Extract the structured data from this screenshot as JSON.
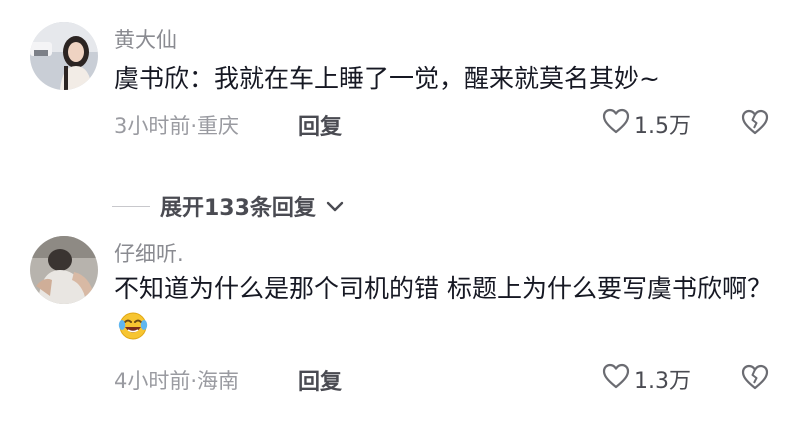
{
  "comments": [
    {
      "username": "黄大仙",
      "text": "虞书欣：我就在车上睡了一觉，醒来就莫名其妙~",
      "meta": "3小时前·重庆",
      "reply_label": "回复",
      "likes": "1.5万"
    },
    {
      "username": "仔细听.",
      "text": "不知道为什么是那个司机的错 标题上为什么要写虞书欣啊？",
      "meta": "4小时前·海南",
      "reply_label": "回复",
      "likes": "1.3万"
    }
  ],
  "expand_replies": "展开133条回复",
  "icons": {
    "like": "heart-outline-icon",
    "dislike": "broken-heart-icon",
    "expand": "chevron-down-icon",
    "emoji": "laughing-crying-emoji"
  },
  "colors": {
    "text": "#161823",
    "muted": "#9a9ba1",
    "action": "#4a4b52"
  }
}
